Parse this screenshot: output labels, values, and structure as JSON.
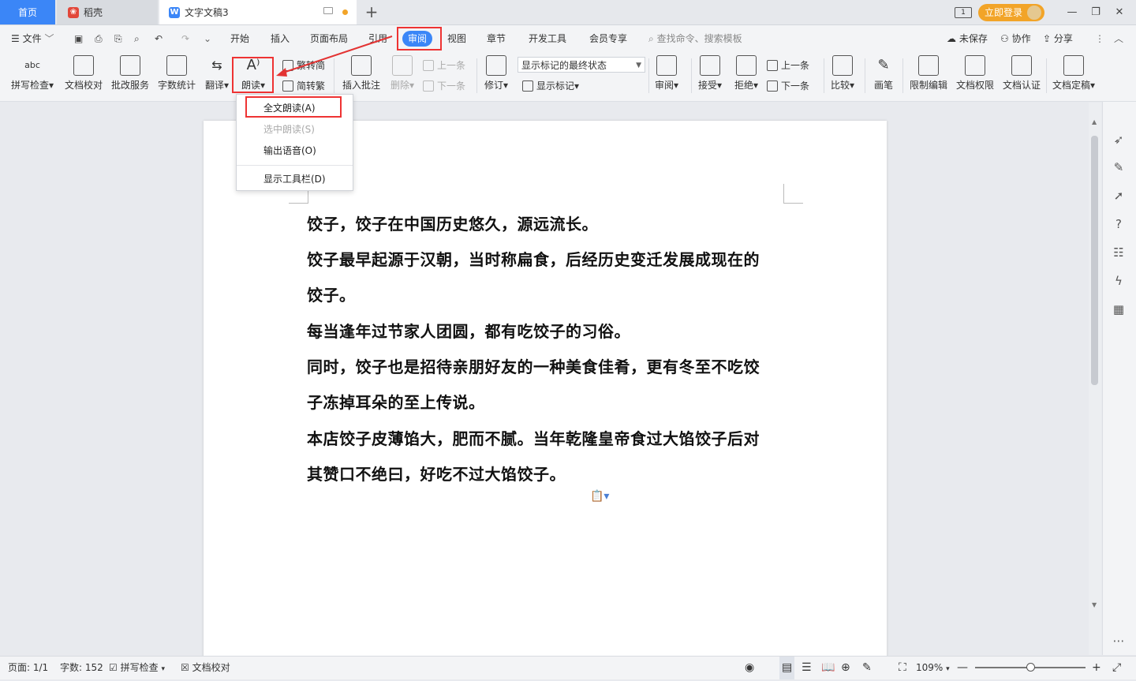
{
  "tabs": {
    "home": "首页",
    "daoke": "稻壳",
    "doc": "文字文稿3"
  },
  "window": {
    "login": "立即登录"
  },
  "menu": {
    "file": "文件",
    "items": [
      "开始",
      "插入",
      "页面布局",
      "引用",
      "审阅",
      "视图",
      "章节",
      "开发工具",
      "会员专享"
    ],
    "search_placeholder": "查找命令、搜索模板",
    "unsaved": "未保存",
    "collab": "协作",
    "share": "分享"
  },
  "ribbon": {
    "spellcheck": "拼写检查",
    "doc_proof": "文档校对",
    "review_service": "批改服务",
    "word_count": "字数统计",
    "translate": "翻译",
    "read_aloud": "朗读",
    "trad_to_simp": "繁转简",
    "simp_to_trad": "简转繁",
    "insert_comment": "插入批注",
    "delete": "删除",
    "prev_comment": "上一条",
    "next_comment": "下一条",
    "revise": "修订",
    "markup_state": "显示标记的最终状态",
    "show_markup": "显示标记",
    "review": "审阅",
    "accept": "接受",
    "reject": "拒绝",
    "prev_change": "上一条",
    "next_change": "下一条",
    "compare": "比较",
    "pen": "画笔",
    "restrict_edit": "限制编辑",
    "doc_permission": "文档权限",
    "doc_cert": "文档认证",
    "doc_finalize": "文档定稿"
  },
  "dropdown": {
    "full_read": "全文朗读(A)",
    "selected_read": "选中朗读(S)",
    "export_voice": "输出语音(O)",
    "show_toolbar": "显示工具栏(D)"
  },
  "document": {
    "lines": [
      "饺子，饺子在中国历史悠久，源远流长。",
      "饺子最早起源于汉朝，当时称扁食，后经历史变迁发展成现在的",
      "饺子。",
      "每当逢年过节家人团圆，都有吃饺子的习俗。",
      "同时，饺子也是招待亲朋好友的一种美食佳肴，更有冬至不吃饺",
      "子冻掉耳朵的至上传说。",
      "本店饺子皮薄馅大，肥而不腻。当年乾隆皇帝食过大馅饺子后对",
      "其赞口不绝曰，好吃不过大馅饺子。"
    ]
  },
  "status": {
    "page": "页面: 1/1",
    "words": "字数: 152",
    "spellcheck": "拼写检查",
    "proof": "文档校对",
    "zoom": "109%"
  },
  "colors": {
    "accent": "#3b86f7",
    "highlight": "#e33333",
    "login": "#f2a428"
  }
}
